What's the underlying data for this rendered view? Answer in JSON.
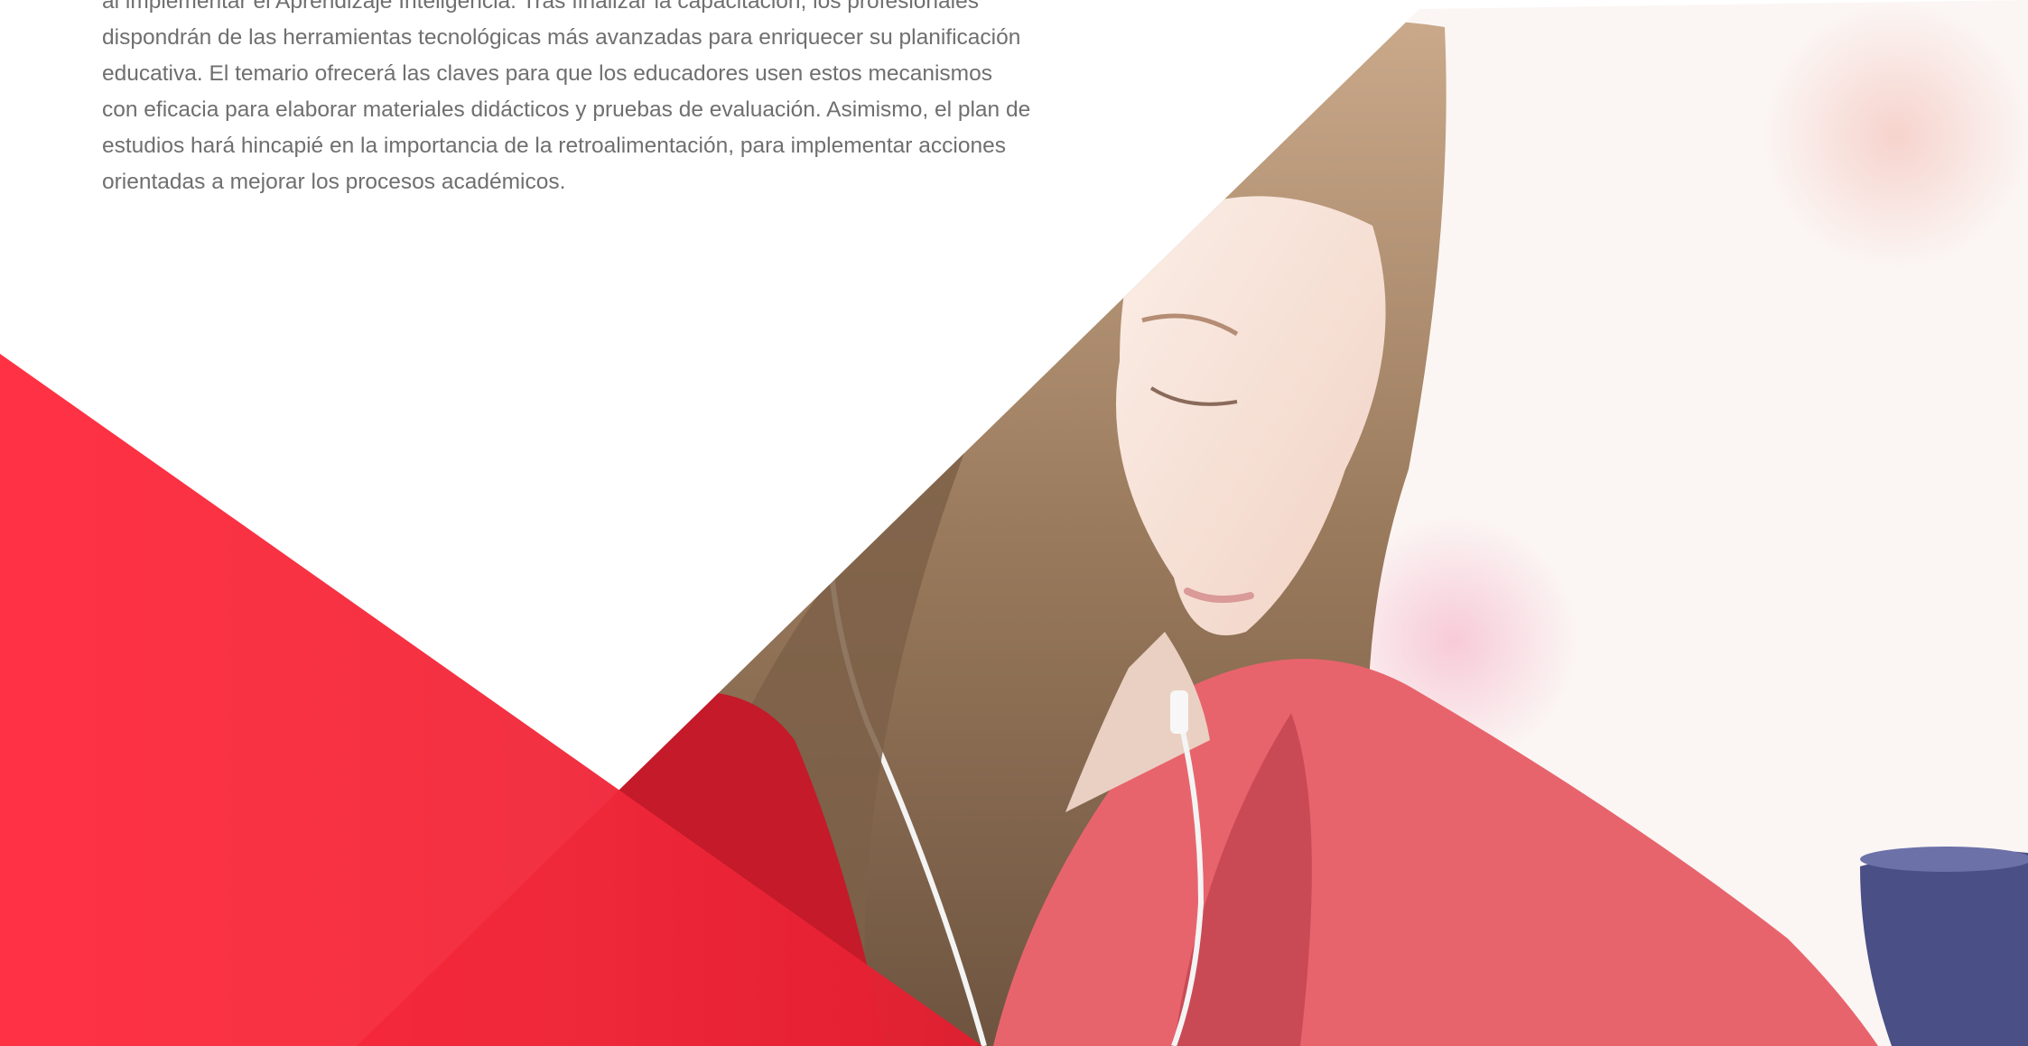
{
  "intro": {
    "lines": [
      "al implementar el Aprendizaje Inteligencia. Tras finalizar la capacitación, los profesionales",
      "dispondrán de las herramientas tecnológicas más avanzadas para enriquecer su planificación",
      "educativa. El temario ofrecerá las claves para que los educadores usen estos mecanismos",
      "con eficacia para elaborar materiales didácticos y pruebas de evaluación. Asimismo, el plan de",
      "estudios hará hincapié en la importancia de la retroalimentación, para implementar acciones",
      "orientadas a mejorar los procesos académicos."
    ]
  },
  "colors": {
    "text": "#6f6f6f",
    "accent_red": "#ff2a3c",
    "background": "#ffffff"
  }
}
